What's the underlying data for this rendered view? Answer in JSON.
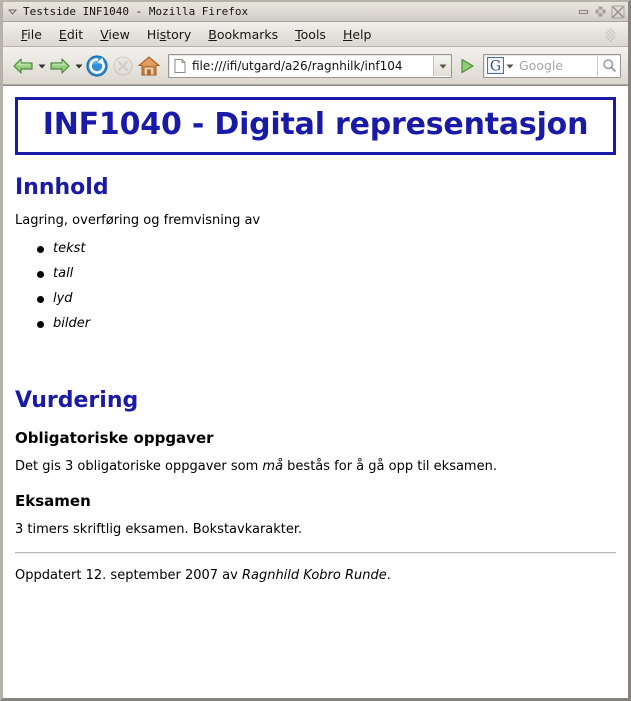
{
  "window": {
    "title": "Testside INF1040 - Mozilla Firefox",
    "system_menu_icon": "window-menu-icon",
    "controls": {
      "minimize": "minimize-icon",
      "maximize": "maximize-icon",
      "close": "close-icon"
    }
  },
  "menubar": {
    "items": [
      {
        "label": "File",
        "accel": "F"
      },
      {
        "label": "Edit",
        "accel": "E"
      },
      {
        "label": "View",
        "accel": "V"
      },
      {
        "label": "History",
        "accel": "s"
      },
      {
        "label": "Bookmarks",
        "accel": "B"
      },
      {
        "label": "Tools",
        "accel": "T"
      },
      {
        "label": "Help",
        "accel": "H"
      }
    ],
    "grip_icon": "grip-diamond-icon"
  },
  "toolbar": {
    "back": {
      "name": "back-icon",
      "enabled": true
    },
    "forward": {
      "name": "forward-icon",
      "enabled": true
    },
    "reload": {
      "name": "reload-icon",
      "enabled": true
    },
    "stop": {
      "name": "stop-icon",
      "enabled": false
    },
    "home": {
      "name": "home-icon",
      "enabled": true
    },
    "url": {
      "favicon": "document-favicon-icon",
      "value": "file:///ifi/utgard/a26/ragnhilk/inf104",
      "placeholder": "",
      "dropdown_icon": "chevron-down-icon"
    },
    "go": {
      "name": "go-arrow-icon"
    },
    "search": {
      "engine_icon": "google-g-icon",
      "engine_caret_icon": "chevron-down-icon",
      "placeholder": "Google",
      "submit_icon": "magnifier-icon"
    }
  },
  "page": {
    "title": "INF1040 - Digital representasjon",
    "sections": {
      "innhold": {
        "heading": "Innhold",
        "intro": "Lagring, overføring og fremvisning av",
        "items": [
          "tekst",
          "tall",
          "lyd",
          "bilder"
        ]
      },
      "vurdering": {
        "heading": "Vurdering",
        "obligatoriske": {
          "heading": "Obligatoriske oppgaver",
          "text_before": "Det gis 3 obligatoriske oppgaver som ",
          "text_emphasis": "må",
          "text_after": " bestås for å gå opp til eksamen."
        },
        "eksamen": {
          "heading": "Eksamen",
          "text": "3 timers skriftlig eksamen. Bokstavkarakter."
        }
      }
    },
    "footer": {
      "text_before": "Oppdatert 12. september 2007 av ",
      "author": "Ragnhild Kobro Runde",
      "text_after": "."
    }
  },
  "colors": {
    "heading_blue": "#1a1aa8",
    "page_background": "#ffffff",
    "chrome_background": "#dedad3"
  }
}
